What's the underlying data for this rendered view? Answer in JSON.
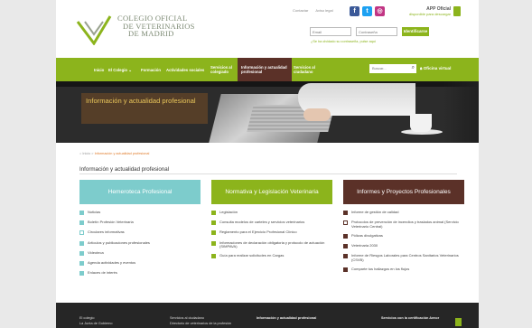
{
  "header": {
    "logo_lines": [
      "COLEGIO OFICIAL",
      "DE VETERINARIOS",
      "DE MADRID"
    ],
    "toplinks": [
      "Contactar",
      "Aviso legal"
    ],
    "social": [
      {
        "icon": "facebook-icon",
        "glyph": "f",
        "color": "#3b5998"
      },
      {
        "icon": "twitter-icon",
        "glyph": "t",
        "color": "#1da1f2"
      },
      {
        "icon": "instagram-icon",
        "glyph": "◎",
        "color": "#c13584"
      }
    ],
    "app": {
      "title": "APP Oficial",
      "subtitle": "disponible para descargar"
    },
    "login": {
      "email_placeholder": "Email",
      "password_placeholder": "Contraseña",
      "button": "Identificarse",
      "forgot": "¿Se ha olvidado su contraseña, pulse aquí"
    }
  },
  "nav": {
    "items": [
      "Inicio",
      "El Colegio ⌄",
      "Formación",
      "Actividades sociales",
      "Servicios al colegiado",
      "Información y actualidad profesional",
      "Servicios al ciudadano"
    ],
    "search_placeholder": "Buscar...",
    "virtual_office": "Oficina virtual"
  },
  "hero": {
    "title": "Información y actualidad profesional"
  },
  "breadcrumb": {
    "home": "Inicio",
    "sep": " > ",
    "current": "Información y actualidad profesional"
  },
  "section_title": "Información y actualidad profesional",
  "columns": [
    {
      "title": "Hemeroteca Profesional",
      "color": "#7dcccc",
      "items": [
        {
          "text": "Noticias",
          "marker": "teal"
        },
        {
          "text": "Boletín Profesión Veterinaria",
          "marker": "teal"
        },
        {
          "text": "Circulares informativas",
          "marker": "teal-o"
        },
        {
          "text": "Artículos y publicaciones profesionales",
          "marker": "teal"
        },
        {
          "text": "Videoteca",
          "marker": "teal"
        },
        {
          "text": "Agenda actividades y eventos",
          "marker": "teal"
        },
        {
          "text": "Enlaces de interés",
          "marker": "teal"
        }
      ]
    },
    {
      "title": "Normativa y Legislación Veterinaria",
      "color": "#8cb41c",
      "items": [
        {
          "text": "Legislación",
          "marker": "green"
        },
        {
          "text": "Consulta modelos de carteles y servicios veterinarios",
          "marker": "green"
        },
        {
          "text": "Reglamento para el Ejercicio Profesional Clínico",
          "marker": "green"
        },
        {
          "text": "Informaciones de declaración obligatoria y protocolo de actuación (SIMPAVA)",
          "marker": "green"
        },
        {
          "text": "Guía para realizar solicitudes en Cargas",
          "marker": "green"
        }
      ]
    },
    {
      "title": "Informes y Proyectos Profesionales",
      "color": "#5b3128",
      "items": [
        {
          "text": "Informe de gestión de calidad",
          "marker": "brown"
        },
        {
          "text": "Protocolos de prevención de incendios y traslados animal (Servicio Veterinario Central)",
          "marker": "brown-o"
        },
        {
          "text": "Pólizas divulgativas",
          "marker": "brown"
        },
        {
          "text": "Veterinaria 2030",
          "marker": "brown"
        },
        {
          "text": "Informe de Riesgos Laborales para Centros Sanitarios Veterinarios (CSVB)",
          "marker": "brown"
        },
        {
          "text": "Comparte tus hallazgos en los flujos",
          "marker": "brown"
        }
      ]
    }
  ],
  "footer": {
    "col1": [
      "El colegio",
      "La Junta de Gobierno"
    ],
    "col2": [
      "Servicios al ciudadano",
      "Directorio de veterinarios de la profesión"
    ],
    "col3": "Información y actualidad profesional",
    "col4": "Servicios con la certificación Aenor"
  },
  "colors": {
    "green": "#8cb41c",
    "teal": "#7dcccc",
    "brown": "#5b3128",
    "hero_gold": "#e8c55a"
  }
}
